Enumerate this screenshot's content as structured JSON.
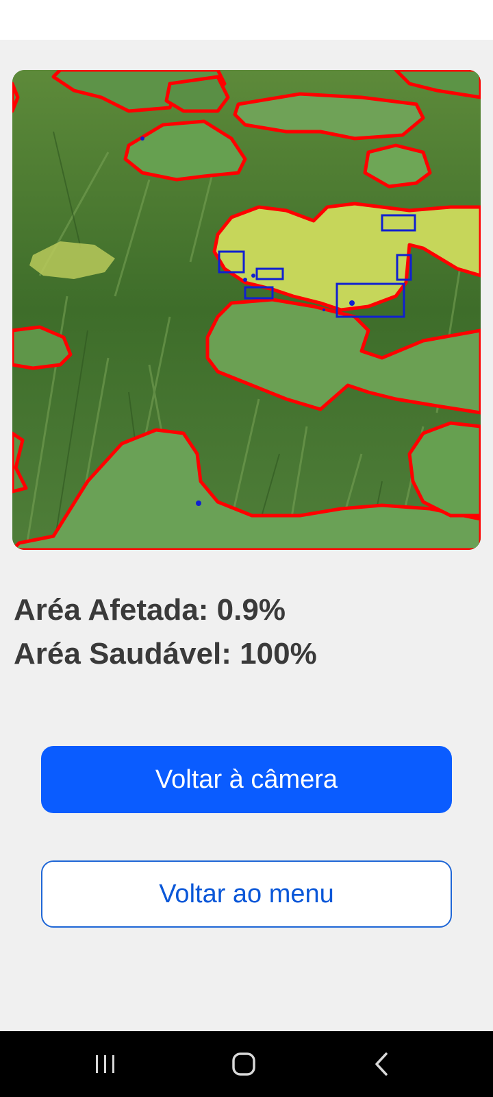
{
  "result": {
    "affected_area": "Aréa Afetada: 0.9%",
    "healthy_area": "Aréa Saudável: 100%"
  },
  "buttons": {
    "back_to_camera": "Voltar à câmera",
    "back_to_menu": "Voltar ao menu"
  },
  "navigation": {
    "recent_apps_icon": "recent-apps-icon",
    "home_icon": "home-icon",
    "back_icon": "back-icon"
  },
  "colors": {
    "primary": "#0a5cff",
    "segmentation_outline": "#ff0000",
    "detection_box": "#1020d0",
    "background": "#f0f0f0"
  }
}
